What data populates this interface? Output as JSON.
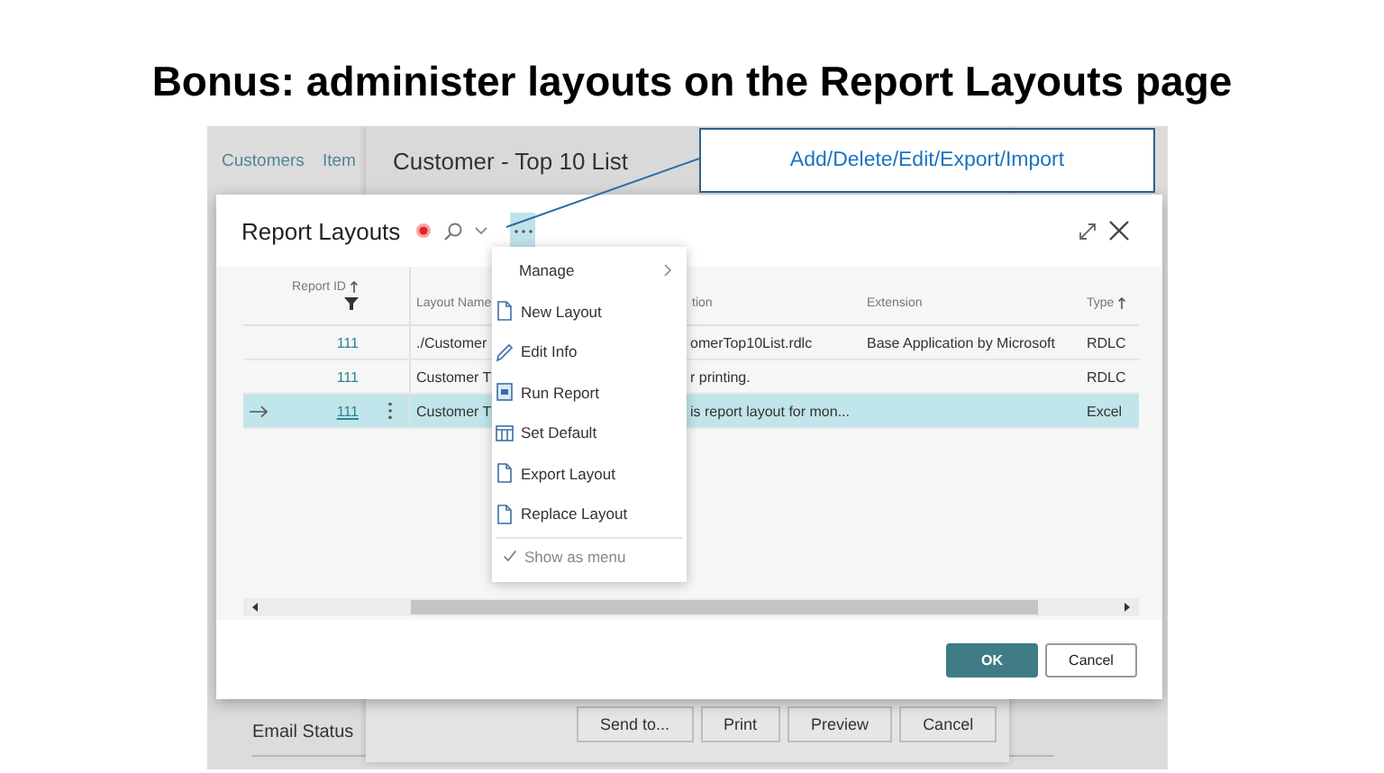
{
  "slide": {
    "title": "Bonus: administer layouts on the Report Layouts page"
  },
  "background_page": {
    "nav": [
      {
        "label": "Customers"
      },
      {
        "label": "Item"
      }
    ],
    "section_title": "Email Status"
  },
  "request_page": {
    "title": "Customer - Top 10 List",
    "buttons": [
      "Send to...",
      "Print",
      "Preview",
      "Cancel"
    ]
  },
  "dialog": {
    "title": "Report Layouts",
    "columns": [
      {
        "label": "Report ID",
        "sorted": true,
        "filtered": true
      },
      {
        "label": "Layout Name",
        "sorted": false,
        "filtered": false
      },
      {
        "label": "tion",
        "sorted": false,
        "filtered": false
      },
      {
        "label": "Extension",
        "sorted": false,
        "filtered": false
      },
      {
        "label": "Type",
        "sorted": true,
        "filtered": false
      }
    ],
    "rows": [
      {
        "selected": false,
        "report_id": "111",
        "layout_name": "./Customer",
        "column_3": "omerTop10List.rdlc",
        "extension": "Base Application by Microsoft",
        "type": "RDLC"
      },
      {
        "selected": false,
        "report_id": "111",
        "layout_name": "Customer T",
        "column_3": "r printing.",
        "extension": "",
        "type": "RDLC"
      },
      {
        "selected": true,
        "report_id": "111",
        "layout_name": "Customer T",
        "column_3": "is report layout for mon...",
        "extension": "",
        "type": "Excel"
      }
    ],
    "buttons": [
      {
        "label": "OK",
        "primary": true
      },
      {
        "label": "Cancel",
        "primary": false
      }
    ]
  },
  "menu": {
    "items": [
      {
        "kind": "submenu",
        "label": "Manage"
      },
      {
        "kind": "action",
        "label": "New Layout"
      },
      {
        "kind": "action",
        "label": "Edit Info"
      },
      {
        "kind": "action",
        "label": "Run Report"
      },
      {
        "kind": "action",
        "label": "Set Default"
      },
      {
        "kind": "action",
        "label": "Export Layout"
      },
      {
        "kind": "action",
        "label": "Replace Layout"
      },
      {
        "kind": "toggle",
        "label": "Show as menu",
        "checked": true
      }
    ]
  },
  "callout": {
    "text": "Add/Delete/Edit/Export/Import"
  }
}
